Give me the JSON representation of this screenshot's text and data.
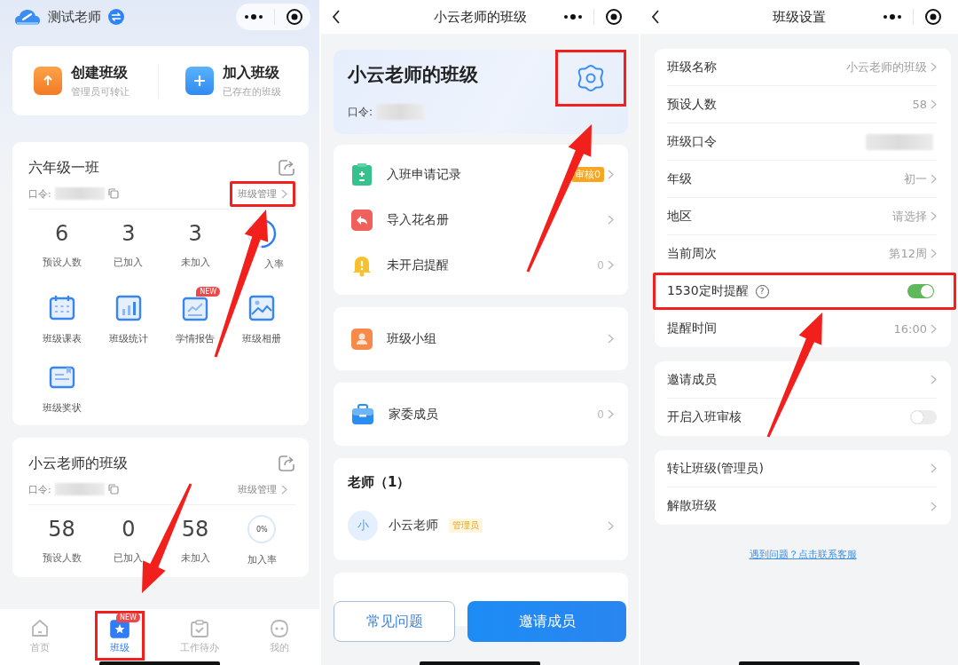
{
  "home": {
    "header": {
      "title": "测试老师"
    },
    "quick_actions": [
      {
        "kind": "create",
        "title": "创建班级",
        "subtitle": "管理员可转让"
      },
      {
        "kind": "join",
        "title": "加入班级",
        "subtitle": "已存在的班级"
      }
    ],
    "classes": [
      {
        "name": "六年级一班",
        "password_label": "口令:",
        "manage": {
          "label": "班级管理",
          "highlighted": true
        },
        "stats": [
          {
            "kind": "number",
            "value": "6",
            "label": "预设人数"
          },
          {
            "kind": "number",
            "value": "3",
            "label": "已加入"
          },
          {
            "kind": "number",
            "value": "3",
            "label": "未加入"
          },
          {
            "kind": "rate",
            "level": 0.5,
            "label": "入率"
          }
        ],
        "tools": [
          {
            "kind": "calendar",
            "label": "班级课表"
          },
          {
            "kind": "stats",
            "label": "班级统计"
          },
          {
            "kind": "report",
            "label": "学情报告",
            "badge": "NEW"
          },
          {
            "kind": "album",
            "label": "班级相册"
          },
          {
            "kind": "award",
            "label": "班级奖状"
          }
        ]
      },
      {
        "name": "小云老师的班级",
        "password_label": "口令:",
        "manage": {
          "label": "班级管理",
          "highlighted": false
        },
        "stats": [
          {
            "kind": "number",
            "value": "58",
            "label": "预设人数"
          },
          {
            "kind": "number",
            "value": "0",
            "label": "已加入"
          },
          {
            "kind": "number",
            "value": "58",
            "label": "未加入"
          },
          {
            "kind": "rate",
            "level": 0,
            "value": "0%",
            "label": "加入率"
          }
        ]
      }
    ],
    "tabs": [
      {
        "kind": "home",
        "label": "首页",
        "selected": false,
        "highlighted": false
      },
      {
        "kind": "class",
        "label": "班级",
        "selected": true,
        "highlighted": true,
        "badge": "NEW"
      },
      {
        "kind": "todo",
        "label": "工作待办",
        "selected": false,
        "highlighted": false
      },
      {
        "kind": "me",
        "label": "我的",
        "selected": false,
        "highlighted": false
      }
    ]
  },
  "class_detail": {
    "title": "小云老师的班级",
    "hero": {
      "name": "小云老师的班级",
      "password_label": "口令:",
      "settings_highlighted": true
    },
    "menu_groups": [
      [
        {
          "kind": "apply",
          "label": "入班申请记录",
          "badge": "审核0"
        },
        {
          "kind": "import",
          "label": "导入花名册"
        },
        {
          "kind": "remind",
          "label": "未开启提醒",
          "count": "0"
        }
      ],
      [
        {
          "kind": "group",
          "label": "班级小组"
        }
      ],
      [
        {
          "kind": "committee",
          "label": "家委成员",
          "count": "0"
        }
      ]
    ],
    "teachers": {
      "title": "老师（1）",
      "members": [
        {
          "avatar": "小",
          "name": "小云老师",
          "role": "管理员"
        }
      ]
    },
    "buttons": [
      {
        "kind": "secondary",
        "label": "常见问题"
      },
      {
        "kind": "primary",
        "label": "邀请成员"
      }
    ]
  },
  "class_settings": {
    "title": "班级设置",
    "groups": [
      [
        {
          "kind": "link",
          "label": "班级名称",
          "value": "小云老师的班级",
          "highlighted": false
        },
        {
          "kind": "link",
          "label": "预设人数",
          "value": "58",
          "highlighted": false
        },
        {
          "kind": "masked",
          "label": "班级口令",
          "highlighted": false
        },
        {
          "kind": "link",
          "label": "年级",
          "value": "初一",
          "highlighted": false
        },
        {
          "kind": "link",
          "label": "地区",
          "value": "请选择",
          "highlighted": false
        },
        {
          "kind": "link",
          "label": "当前周次",
          "value": "第12周",
          "highlighted": false
        },
        {
          "kind": "switch",
          "label": "1530定时提醒",
          "help": "?",
          "on": true,
          "highlighted": true
        },
        {
          "kind": "link",
          "label": "提醒时间",
          "value": "16:00",
          "highlighted": false
        }
      ],
      [
        {
          "kind": "link",
          "label": "邀请成员",
          "highlighted": false
        },
        {
          "kind": "switch",
          "label": "开启入班审核",
          "on": false,
          "highlighted": false
        }
      ],
      [
        {
          "kind": "link",
          "label": "转让班级(管理员)",
          "highlighted": false
        },
        {
          "kind": "link",
          "label": "解散班级",
          "highlighted": false
        }
      ]
    ],
    "help_link": "遇到问题？点击联系客服"
  }
}
